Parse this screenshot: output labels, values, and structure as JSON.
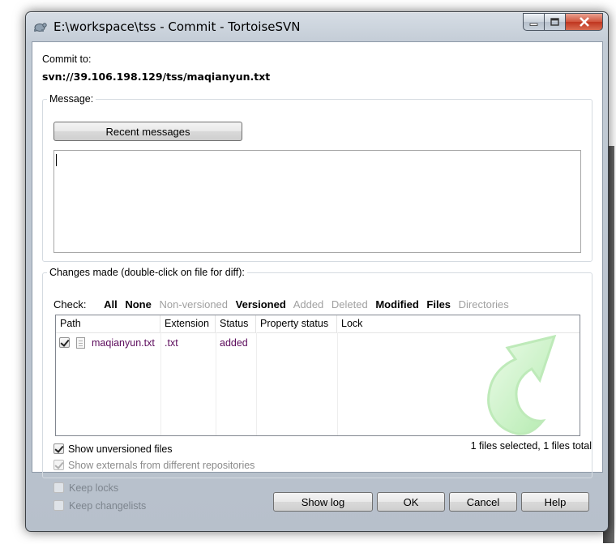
{
  "window": {
    "title": "E:\\workspace\\tss - Commit - TortoiseSVN"
  },
  "commit": {
    "label": "Commit to:",
    "url": "svn://39.106.198.129/tss/maqianyun.txt"
  },
  "message": {
    "label": "Message:",
    "recent_button": "Recent messages",
    "text": ""
  },
  "changes": {
    "label": "Changes made (double-click on file for diff):",
    "check_label": "Check:",
    "filters": [
      {
        "label": "All",
        "enabled": true
      },
      {
        "label": "None",
        "enabled": true
      },
      {
        "label": "Non-versioned",
        "enabled": false
      },
      {
        "label": "Versioned",
        "enabled": true
      },
      {
        "label": "Added",
        "enabled": false
      },
      {
        "label": "Deleted",
        "enabled": false
      },
      {
        "label": "Modified",
        "enabled": true
      },
      {
        "label": "Files",
        "enabled": true
      },
      {
        "label": "Directories",
        "enabled": false
      }
    ],
    "columns": [
      "Path",
      "Extension",
      "Status",
      "Property status",
      "Lock"
    ],
    "rows": [
      {
        "checked": true,
        "path": "maqianyun.txt",
        "extension": ".txt",
        "status": "added",
        "property_status": "",
        "lock": ""
      }
    ],
    "show_unversioned": {
      "label": "Show unversioned files",
      "checked": true
    },
    "show_externals": {
      "label": "Show externals from different repositories",
      "checked": true,
      "enabled": false
    },
    "summary": "1 files selected, 1 files total"
  },
  "options": {
    "keep_locks": {
      "label": "Keep locks",
      "checked": false,
      "enabled": false
    },
    "keep_changelists": {
      "label": "Keep changelists",
      "checked": false,
      "enabled": false
    }
  },
  "buttons": {
    "show_log": "Show log",
    "ok": "OK",
    "cancel": "Cancel",
    "help": "Help"
  },
  "colors": {
    "file_text": "#5b0a5b",
    "disabled_text": "#a0a0a0",
    "arrow_green": "#8fe08a"
  }
}
